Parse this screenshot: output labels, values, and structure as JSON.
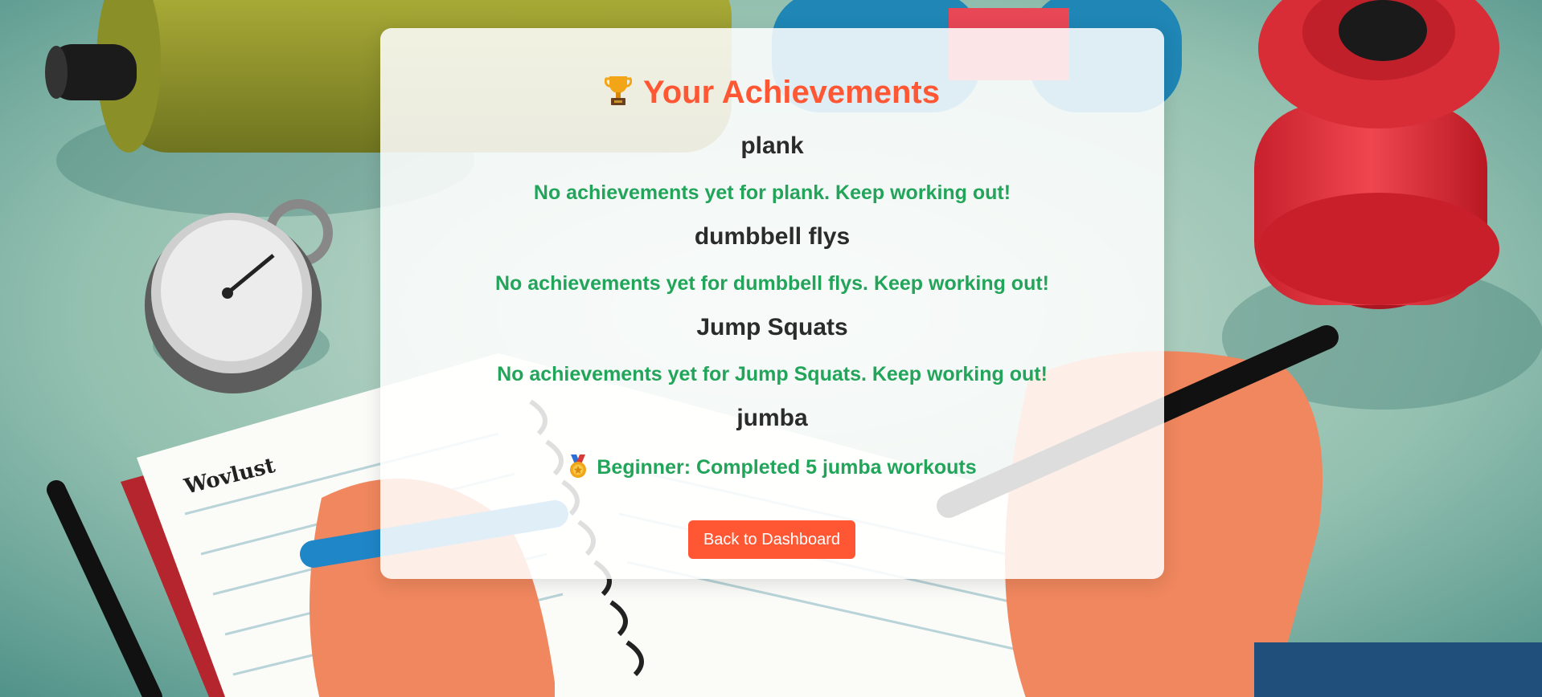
{
  "page": {
    "title": "Your Achievements",
    "accent_color": "#ff5733",
    "success_color": "#22a55a",
    "title_icon": "trophy-icon"
  },
  "background": {
    "notebook_heading": "Wovlust"
  },
  "sections": [
    {
      "name": "plank",
      "message": "No achievements yet for plank. Keep working out!"
    },
    {
      "name": "dumbbell flys",
      "message": "No achievements yet for dumbbell flys. Keep working out!"
    },
    {
      "name": "Jump Squats",
      "message": "No achievements yet for Jump Squats. Keep working out!"
    },
    {
      "name": "jumba",
      "achievement": "Beginner: Completed 5 jumba workouts",
      "achievement_icon": "medal-icon"
    }
  ],
  "actions": {
    "back_label": "Back to Dashboard"
  }
}
